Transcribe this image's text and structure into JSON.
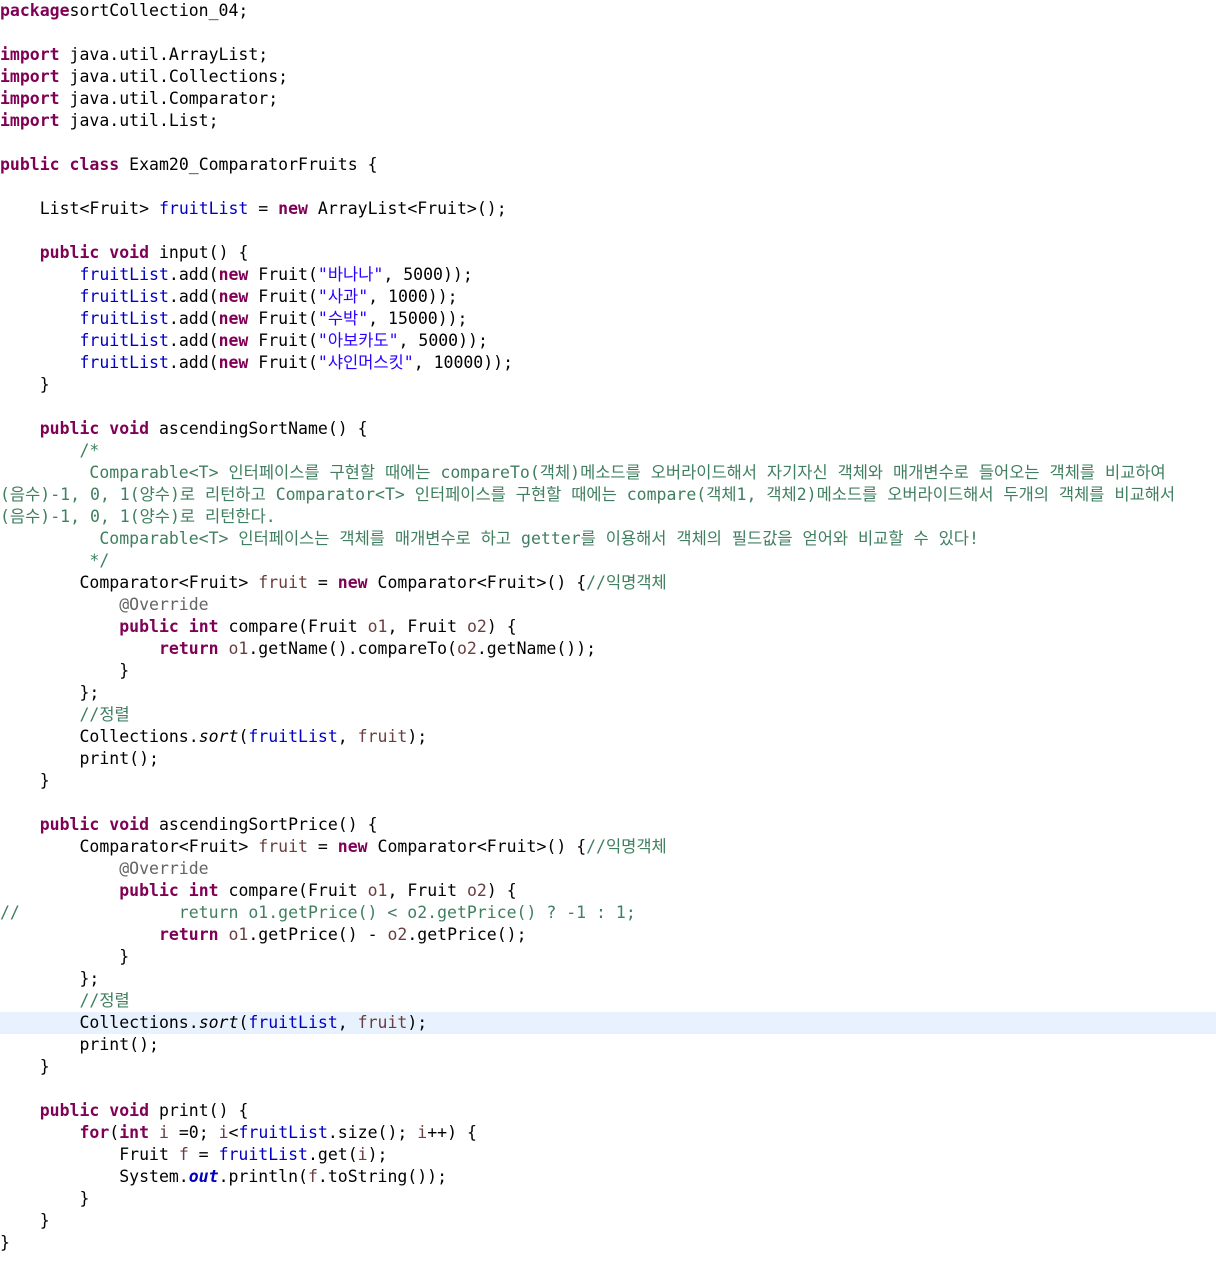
{
  "editor": {
    "language": "java",
    "highlight_color": "#e8f2fe",
    "syntax_colors": {
      "keyword": "#7f0055",
      "field": "#0000c0",
      "string": "#2a00ff",
      "comment": "#3f7f5f",
      "annotation": "#646464",
      "local_variable": "#6a3e3e",
      "default": "#000000"
    },
    "current_line": 46,
    "lines": [
      [
        [
          "kw",
          "package"
        ],
        [
          "",
          "sortCollection_04;"
        ]
      ],
      [],
      [
        [
          "kw",
          "import"
        ],
        [
          "",
          " java.util.ArrayList;"
        ]
      ],
      [
        [
          "kw",
          "import"
        ],
        [
          "",
          " java.util.Collections;"
        ]
      ],
      [
        [
          "kw",
          "import"
        ],
        [
          "",
          " java.util.Comparator;"
        ]
      ],
      [
        [
          "kw",
          "import"
        ],
        [
          "",
          " java.util.List;"
        ]
      ],
      [],
      [
        [
          "kw",
          "public"
        ],
        [
          "",
          " "
        ],
        [
          "kw",
          "class"
        ],
        [
          "",
          " Exam20_ComparatorFruits {"
        ]
      ],
      [],
      [
        [
          "",
          "    List<Fruit> "
        ],
        [
          "field",
          "fruitList"
        ],
        [
          "",
          " = "
        ],
        [
          "kw",
          "new"
        ],
        [
          "",
          " ArrayList<Fruit>();"
        ]
      ],
      [],
      [
        [
          "",
          "    "
        ],
        [
          "kw",
          "public"
        ],
        [
          "",
          " "
        ],
        [
          "kw",
          "void"
        ],
        [
          "",
          " input() {"
        ]
      ],
      [
        [
          "",
          "        "
        ],
        [
          "field",
          "fruitList"
        ],
        [
          "",
          ".add("
        ],
        [
          "kw",
          "new"
        ],
        [
          "",
          " Fruit("
        ],
        [
          "str",
          "\"바나나\""
        ],
        [
          "",
          ", 5000));"
        ]
      ],
      [
        [
          "",
          "        "
        ],
        [
          "field",
          "fruitList"
        ],
        [
          "",
          ".add("
        ],
        [
          "kw",
          "new"
        ],
        [
          "",
          " Fruit("
        ],
        [
          "str",
          "\"사과\""
        ],
        [
          "",
          ", 1000));"
        ]
      ],
      [
        [
          "",
          "        "
        ],
        [
          "field",
          "fruitList"
        ],
        [
          "",
          ".add("
        ],
        [
          "kw",
          "new"
        ],
        [
          "",
          " Fruit("
        ],
        [
          "str",
          "\"수박\""
        ],
        [
          "",
          ", 15000));"
        ]
      ],
      [
        [
          "",
          "        "
        ],
        [
          "field",
          "fruitList"
        ],
        [
          "",
          ".add("
        ],
        [
          "kw",
          "new"
        ],
        [
          "",
          " Fruit("
        ],
        [
          "str",
          "\"아보카도\""
        ],
        [
          "",
          ", 5000));"
        ]
      ],
      [
        [
          "",
          "        "
        ],
        [
          "field",
          "fruitList"
        ],
        [
          "",
          ".add("
        ],
        [
          "kw",
          "new"
        ],
        [
          "",
          " Fruit("
        ],
        [
          "str",
          "\"샤인머스킷\""
        ],
        [
          "",
          ", 10000));"
        ]
      ],
      [
        [
          "",
          "    }"
        ]
      ],
      [],
      [
        [
          "",
          "    "
        ],
        [
          "kw",
          "public"
        ],
        [
          "",
          " "
        ],
        [
          "kw",
          "void"
        ],
        [
          "",
          " ascendingSortName() {"
        ]
      ],
      [
        [
          "com",
          "        /*"
        ]
      ],
      [
        [
          "com",
          "         Comparable<T> 인터페이스를 구현할 때에는 compareTo(객체)메소드를 오버라이드해서 자기자신 객체와 매개변수로 들어오는 객체를 비교하여"
        ]
      ],
      [
        [
          "com",
          "(음수)-1, 0, 1(양수)로 리턴하고 Comparator<T> 인터페이스를 구현할 때에는 compare(객체1, 객체2)메소드를 오버라이드해서 두개의 객체를 비교해서"
        ]
      ],
      [
        [
          "com",
          "(음수)-1, 0, 1(양수)로 리턴한다."
        ]
      ],
      [
        [
          "com",
          "          Comparable<T> 인터페이스는 객체를 매개변수로 하고 getter를 이용해서 객체의 필드값을 얻어와 비교할 수 있다!"
        ]
      ],
      [
        [
          "com",
          "         */"
        ]
      ],
      [
        [
          "",
          "        Comparator<Fruit> "
        ],
        [
          "loc",
          "fruit"
        ],
        [
          "",
          " = "
        ],
        [
          "kw",
          "new"
        ],
        [
          "",
          " Comparator<Fruit>() {"
        ],
        [
          "com",
          "//익명객체"
        ]
      ],
      [
        [
          "ann",
          "            @Override"
        ]
      ],
      [
        [
          "",
          "            "
        ],
        [
          "kw",
          "public"
        ],
        [
          "",
          " "
        ],
        [
          "kw",
          "int"
        ],
        [
          "",
          " compare(Fruit "
        ],
        [
          "loc",
          "o1"
        ],
        [
          "",
          ", Fruit "
        ],
        [
          "loc",
          "o2"
        ],
        [
          "",
          ") {"
        ]
      ],
      [
        [
          "",
          "                "
        ],
        [
          "kw",
          "return"
        ],
        [
          "",
          " "
        ],
        [
          "loc",
          "o1"
        ],
        [
          "",
          ".getName().compareTo("
        ],
        [
          "loc",
          "o2"
        ],
        [
          "",
          ".getName());"
        ]
      ],
      [
        [
          "",
          "            }"
        ]
      ],
      [
        [
          "",
          "        };"
        ]
      ],
      [
        [
          "com",
          "        //정렬"
        ]
      ],
      [
        [
          "",
          "        Collections."
        ],
        [
          "italic",
          "sort"
        ],
        [
          "",
          "("
        ],
        [
          "field",
          "fruitList"
        ],
        [
          "",
          ", "
        ],
        [
          "loc",
          "fruit"
        ],
        [
          "",
          ");"
        ]
      ],
      [
        [
          "",
          "        print();"
        ]
      ],
      [
        [
          "",
          "    }"
        ]
      ],
      [],
      [
        [
          "",
          "    "
        ],
        [
          "kw",
          "public"
        ],
        [
          "",
          " "
        ],
        [
          "kw",
          "void"
        ],
        [
          "",
          " ascendingSortPrice() {"
        ]
      ],
      [
        [
          "",
          "        Comparator<Fruit> "
        ],
        [
          "loc",
          "fruit"
        ],
        [
          "",
          " = "
        ],
        [
          "kw",
          "new"
        ],
        [
          "",
          " Comparator<Fruit>() {"
        ],
        [
          "com",
          "//익명객체"
        ]
      ],
      [
        [
          "ann",
          "            @Override"
        ]
      ],
      [
        [
          "",
          "            "
        ],
        [
          "kw",
          "public"
        ],
        [
          "",
          " "
        ],
        [
          "kw",
          "int"
        ],
        [
          "",
          " compare(Fruit "
        ],
        [
          "loc",
          "o1"
        ],
        [
          "",
          ", Fruit "
        ],
        [
          "loc",
          "o2"
        ],
        [
          "",
          ") {"
        ]
      ],
      [
        [
          "com",
          "//                return o1.getPrice() < o2.getPrice() ? -1 : 1;"
        ]
      ],
      [
        [
          "",
          "                "
        ],
        [
          "kw",
          "return"
        ],
        [
          "",
          " "
        ],
        [
          "loc",
          "o1"
        ],
        [
          "",
          ".getPrice() - "
        ],
        [
          "loc",
          "o2"
        ],
        [
          "",
          ".getPrice();"
        ]
      ],
      [
        [
          "",
          "            }"
        ]
      ],
      [
        [
          "",
          "        };"
        ]
      ],
      [
        [
          "com",
          "        //정렬"
        ]
      ],
      [
        [
          "",
          "        Collections."
        ],
        [
          "italic",
          "sort"
        ],
        [
          "",
          "("
        ],
        [
          "field",
          "fruitList"
        ],
        [
          "",
          ", "
        ],
        [
          "loc",
          "fruit"
        ],
        [
          "",
          ");"
        ]
      ],
      [
        [
          "",
          "        print();"
        ]
      ],
      [
        [
          "",
          "    }"
        ]
      ],
      [],
      [
        [
          "",
          "    "
        ],
        [
          "kw",
          "public"
        ],
        [
          "",
          " "
        ],
        [
          "kw",
          "void"
        ],
        [
          "",
          " print() {"
        ]
      ],
      [
        [
          "",
          "        "
        ],
        [
          "kw",
          "for"
        ],
        [
          "",
          "("
        ],
        [
          "kw",
          "int"
        ],
        [
          "",
          " "
        ],
        [
          "loc",
          "i"
        ],
        [
          "",
          " =0; "
        ],
        [
          "loc",
          "i"
        ],
        [
          "",
          "<"
        ],
        [
          "field",
          "fruitList"
        ],
        [
          "",
          ".size(); "
        ],
        [
          "loc",
          "i"
        ],
        [
          "",
          "++) {"
        ]
      ],
      [
        [
          "",
          "            Fruit "
        ],
        [
          "loc",
          "f"
        ],
        [
          "",
          " = "
        ],
        [
          "field",
          "fruitList"
        ],
        [
          "",
          ".get("
        ],
        [
          "loc",
          "i"
        ],
        [
          "",
          ");"
        ]
      ],
      [
        [
          "",
          "            System."
        ],
        [
          "static-field",
          "out"
        ],
        [
          "",
          ".println("
        ],
        [
          "loc",
          "f"
        ],
        [
          "",
          ".toString());"
        ]
      ],
      [
        [
          "",
          "        }"
        ]
      ],
      [
        [
          "",
          "    }"
        ]
      ],
      [
        [
          "",
          "}"
        ]
      ]
    ]
  }
}
